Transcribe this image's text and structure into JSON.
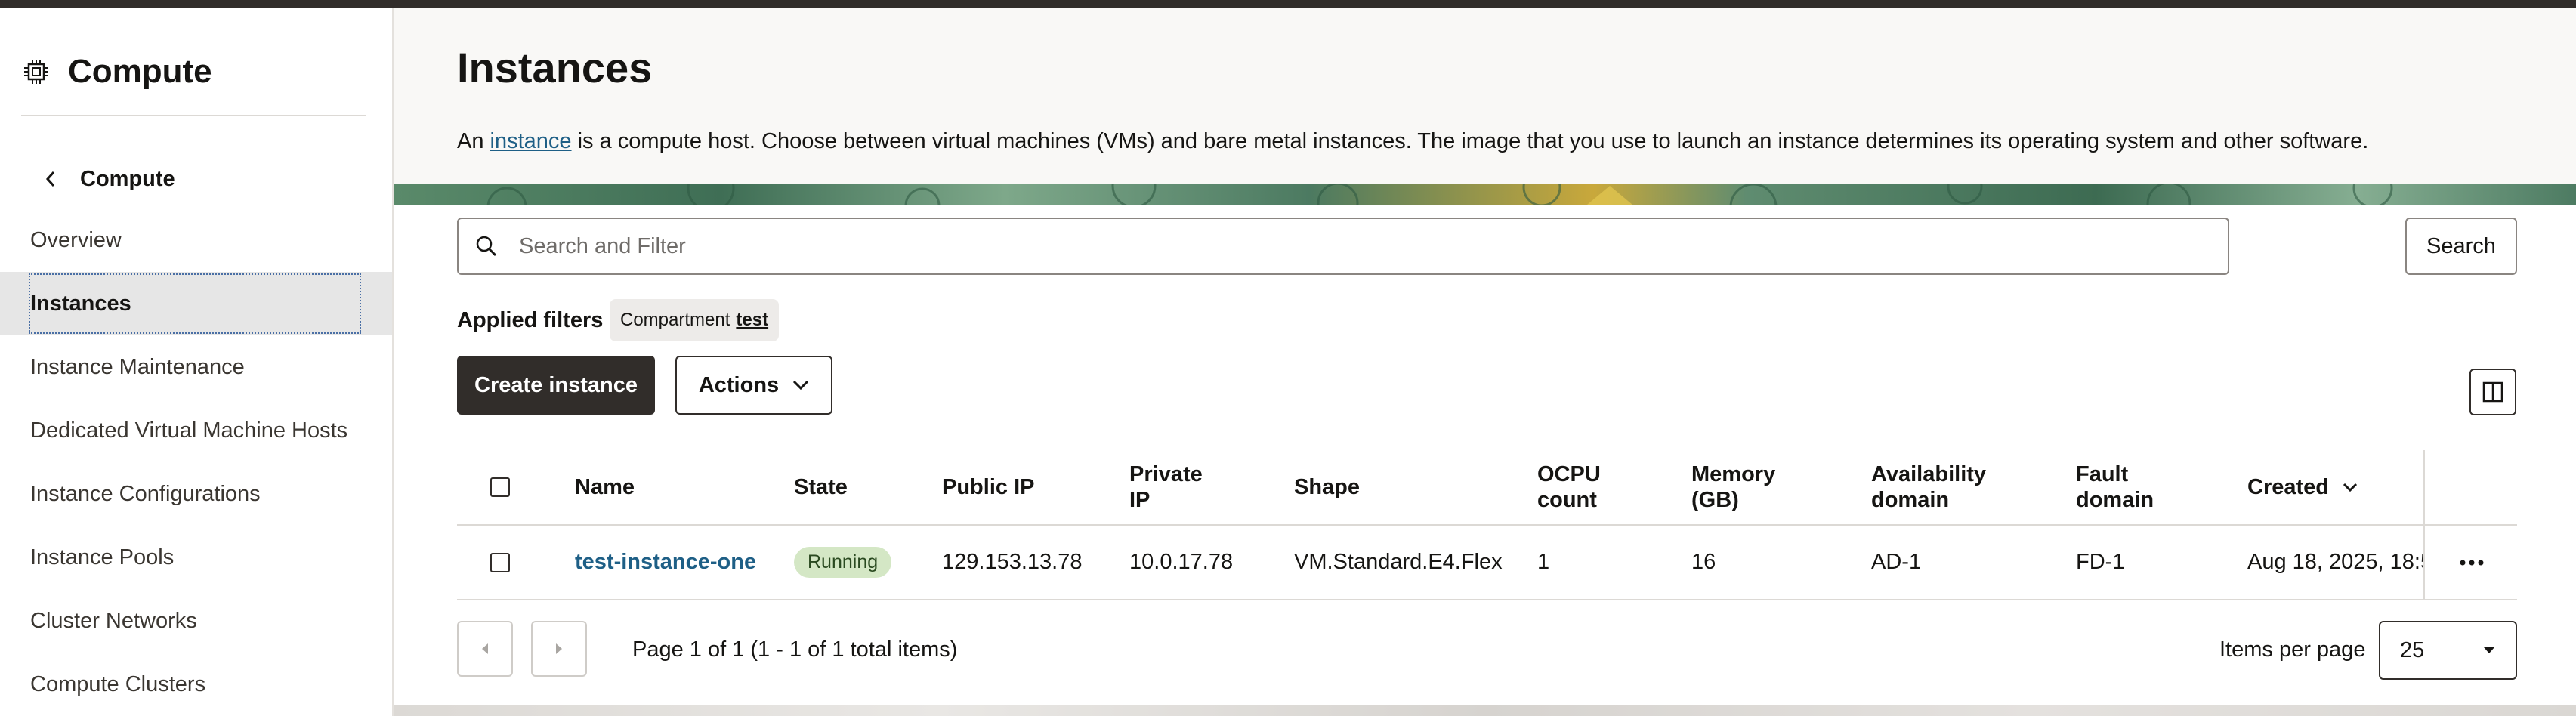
{
  "sidebar": {
    "title": "Compute",
    "back_label": "Compute",
    "items": [
      {
        "label": "Overview"
      },
      {
        "label": "Instances",
        "active": true
      },
      {
        "label": "Instance Maintenance"
      },
      {
        "label": "Dedicated Virtual Machine Hosts"
      },
      {
        "label": "Instance Configurations"
      },
      {
        "label": "Instance Pools"
      },
      {
        "label": "Cluster Networks"
      },
      {
        "label": "Compute Clusters"
      }
    ]
  },
  "header": {
    "title": "Instances",
    "description_prefix": "An ",
    "description_link": "instance",
    "description_suffix": " is a compute host. Choose between virtual machines (VMs) and bare metal instances. The image that you use to launch an instance determines its operating system and other software."
  },
  "search": {
    "placeholder": "Search and Filter",
    "value": "",
    "button_label": "Search"
  },
  "filters": {
    "label": "Applied filters",
    "chip_key": "Compartment",
    "chip_value": "test"
  },
  "toolbar": {
    "create_label": "Create instance",
    "actions_label": "Actions"
  },
  "table": {
    "columns": {
      "name": "Name",
      "state": "State",
      "public_ip": "Public IP",
      "private_ip_1": "Private",
      "private_ip_2": "IP",
      "shape": "Shape",
      "ocpu_1": "OCPU",
      "ocpu_2": "count",
      "memory_1": "Memory",
      "memory_2": "(GB)",
      "ad_1": "Availability",
      "ad_2": "domain",
      "fd_1": "Fault",
      "fd_2": "domain",
      "created": "Created"
    },
    "rows": [
      {
        "name": "test-instance-one",
        "state": "Running",
        "public_ip": "129.153.13.78",
        "private_ip": "10.0.17.78",
        "shape": "VM.Standard.E4.Flex",
        "ocpu": "1",
        "memory": "16",
        "ad": "AD-1",
        "fd": "FD-1",
        "created": "Aug 18, 2025, 18:5"
      }
    ]
  },
  "pagination": {
    "text": "Page 1 of 1 (1 - 1 of 1 total items)",
    "items_per_page_label": "Items per page",
    "items_per_page_value": "25"
  },
  "colors": {
    "topbar": "#312d2a",
    "link": "#1e5f86",
    "running_badge_bg": "#d4e7c5",
    "primary_button": "#312d2a"
  },
  "icons": [
    "chip-icon",
    "chevron-left-icon",
    "search-icon",
    "chevron-down-icon",
    "columns-panel-icon",
    "sort-down-icon",
    "more-horizontal-icon",
    "caret-left-icon",
    "caret-right-icon",
    "caret-down-icon"
  ]
}
